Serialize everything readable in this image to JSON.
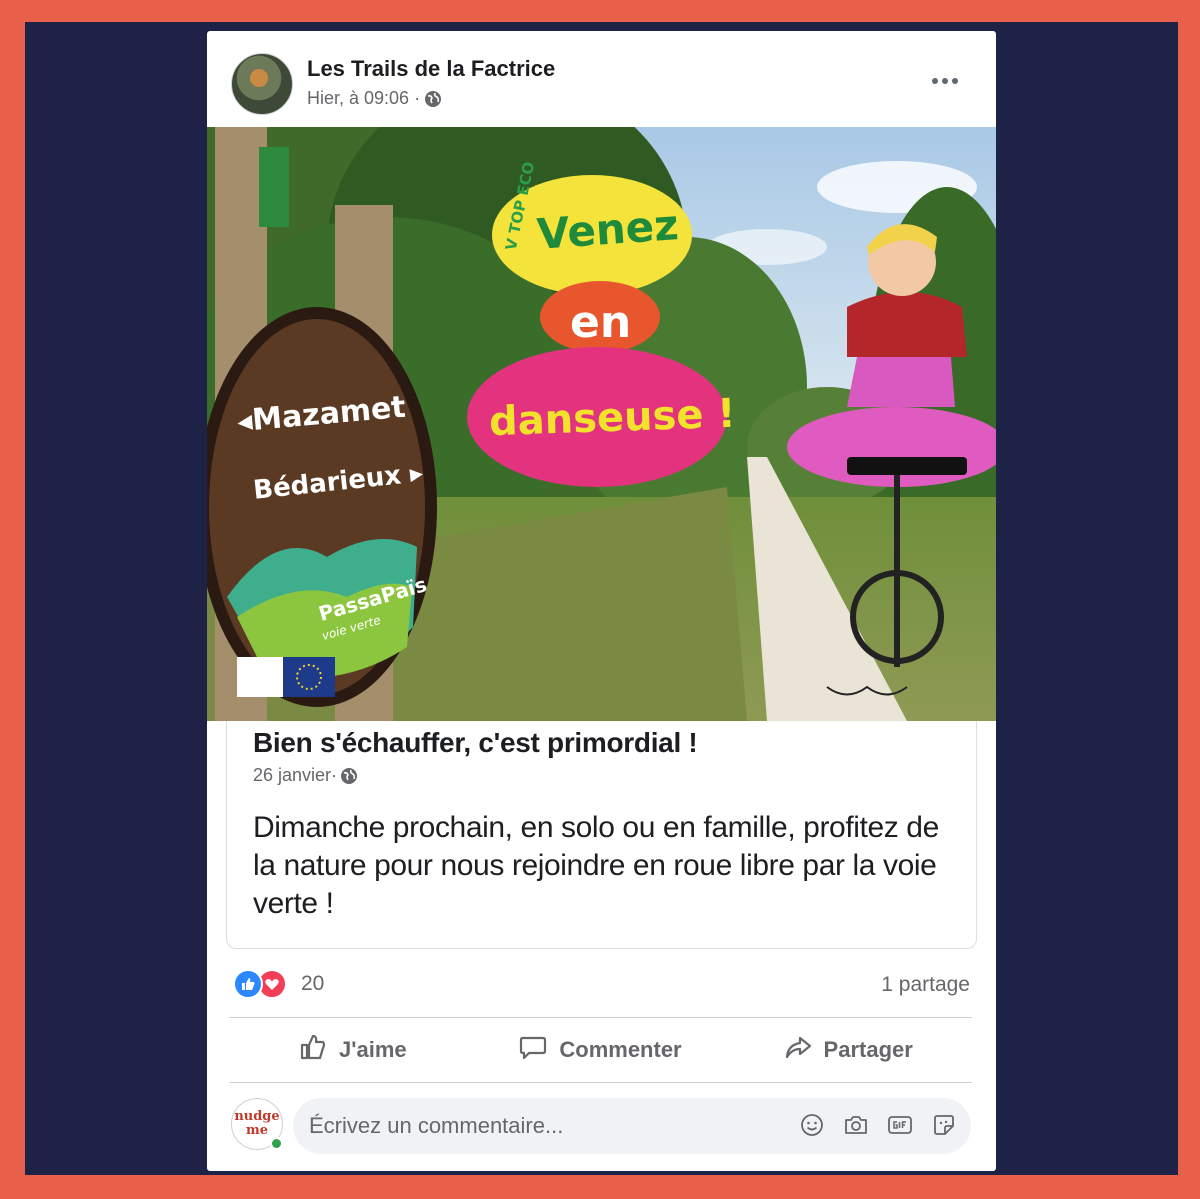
{
  "post": {
    "author": "Les Trails de la Factrice",
    "timestamp": "Hier, à 09:06 ·",
    "privacy_icon": "globe-icon",
    "more_icon": "more-horizontal-icon"
  },
  "image": {
    "bubble_1": "Venez",
    "bubble_2": "en",
    "bubble_3": "danseuse !",
    "sign_line_1": "◂Mazamet",
    "sign_line_2": "Bédarieux ▸",
    "sign_brand": "PassaPaïs",
    "sign_brand_sub": "voie verte",
    "eco_label": "V TOP ECO"
  },
  "shared": {
    "title": "Bien s'échauffer, c'est primordial !",
    "date": "26 janvier·",
    "text": "Dimanche prochain, en solo ou en famille, profitez de la nature pour nous rejoindre en roue libre par la voie verte !"
  },
  "reactions": {
    "count": "20",
    "shares": "1 partage"
  },
  "actions": {
    "like": "J'aime",
    "comment": "Commenter",
    "share": "Partager"
  },
  "composer": {
    "avatar_text": "nudge me",
    "placeholder": "Écrivez un commentaire..."
  },
  "colors": {
    "frame": "#e8604a",
    "background": "#1e2247",
    "like_blue": "#2d88ff",
    "love_red": "#f33e58",
    "bubble_yellow": "#f3e33a",
    "bubble_orange": "#e8562e",
    "bubble_pink": "#e3337f"
  }
}
